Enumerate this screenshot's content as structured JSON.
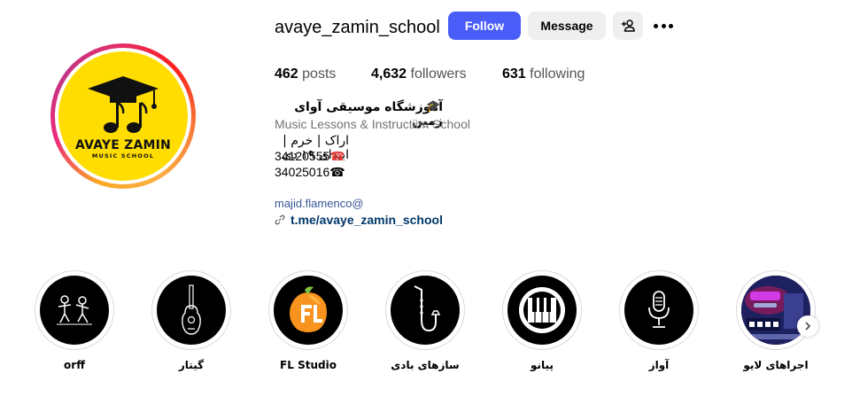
{
  "profile": {
    "username": "avaye_zamin_school",
    "avatar": {
      "logo_title": "AVAYE ZAMIN",
      "logo_subtitle": "MUSIC SCHOOL",
      "brand_color": "#ffdd00"
    }
  },
  "actions": {
    "follow_label": "Follow",
    "message_label": "Message",
    "add_user_icon": "person-add-icon",
    "more_icon": "more-horizontal-icon",
    "follow_color": "#4a5df9"
  },
  "stats": {
    "posts": {
      "count": "462",
      "label": "posts"
    },
    "followers": {
      "count": "4,632",
      "label": "followers"
    },
    "following": {
      "count": "631",
      "label": "following"
    }
  },
  "bio": {
    "name": "آموزشگاه موسیقی آوای زمین",
    "name_emoji": "🎓",
    "category": "Music Lessons & Instruction School",
    "location": "اراک | خرم | ابتدای ۱۹ دی",
    "phone1": "34120555",
    "phone1_emoji": "☎",
    "phone2": "34025016",
    "phone2_emoji": "☎",
    "email": "majid.flamenco@",
    "link": "t.me/avaye_zamin_school",
    "link_icon": "link-icon"
  },
  "highlights": [
    {
      "label": "orff",
      "icon": "orff-dancers-icon"
    },
    {
      "label": "گیتار",
      "icon": "guitar-icon"
    },
    {
      "label": "FL Studio",
      "icon": "fl-studio-icon"
    },
    {
      "label": "سازهای بادی",
      "icon": "saxophone-icon"
    },
    {
      "label": "پیانو",
      "icon": "piano-icon"
    },
    {
      "label": "آواز",
      "icon": "microphone-icon"
    },
    {
      "label": "اجراهای لایو",
      "icon": "live-poster-icon"
    }
  ]
}
